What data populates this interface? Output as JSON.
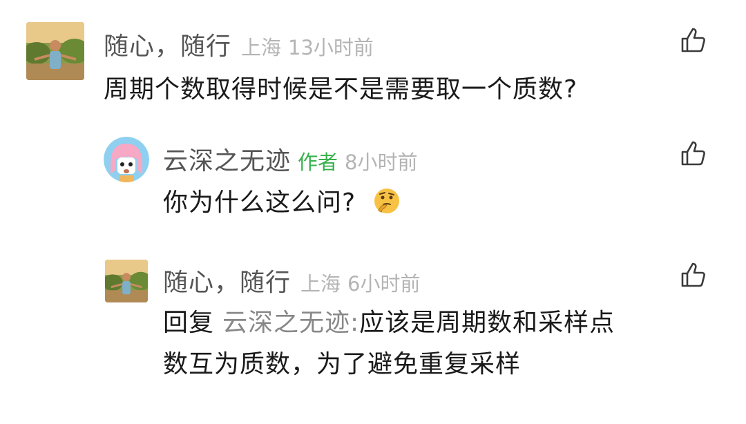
{
  "comments": [
    {
      "name": "随心，随行",
      "location": "上海",
      "time": "13小时前",
      "text": "周期个数取得时候是不是需要取一个质数?",
      "like_icon": "thumbs-up-icon",
      "avatar": "avatar-photo-man"
    },
    {
      "name": "云深之无迹",
      "badge": "作者",
      "time": "8小时前",
      "text": "你为什么这么问?",
      "emoji": "thinking-face-emoji",
      "like_icon": "thumbs-up-icon",
      "avatar": "avatar-cartoon-girl"
    },
    {
      "name": "随心，随行",
      "location": "上海",
      "time": "6小时前",
      "reply_prefix": "回复",
      "reply_to": "云深之无迹",
      "reply_colon": ":",
      "text_line1": "应该是周期数和采样点",
      "text_line2": "数互为质数，为了避免重复采样",
      "like_icon": "thumbs-up-icon",
      "avatar": "avatar-photo-man"
    }
  ],
  "colors": {
    "name": "#555555",
    "meta": "#b4b4b4",
    "author_badge": "#35b04a",
    "text": "#1a1a1a",
    "reply_target": "#888888"
  }
}
